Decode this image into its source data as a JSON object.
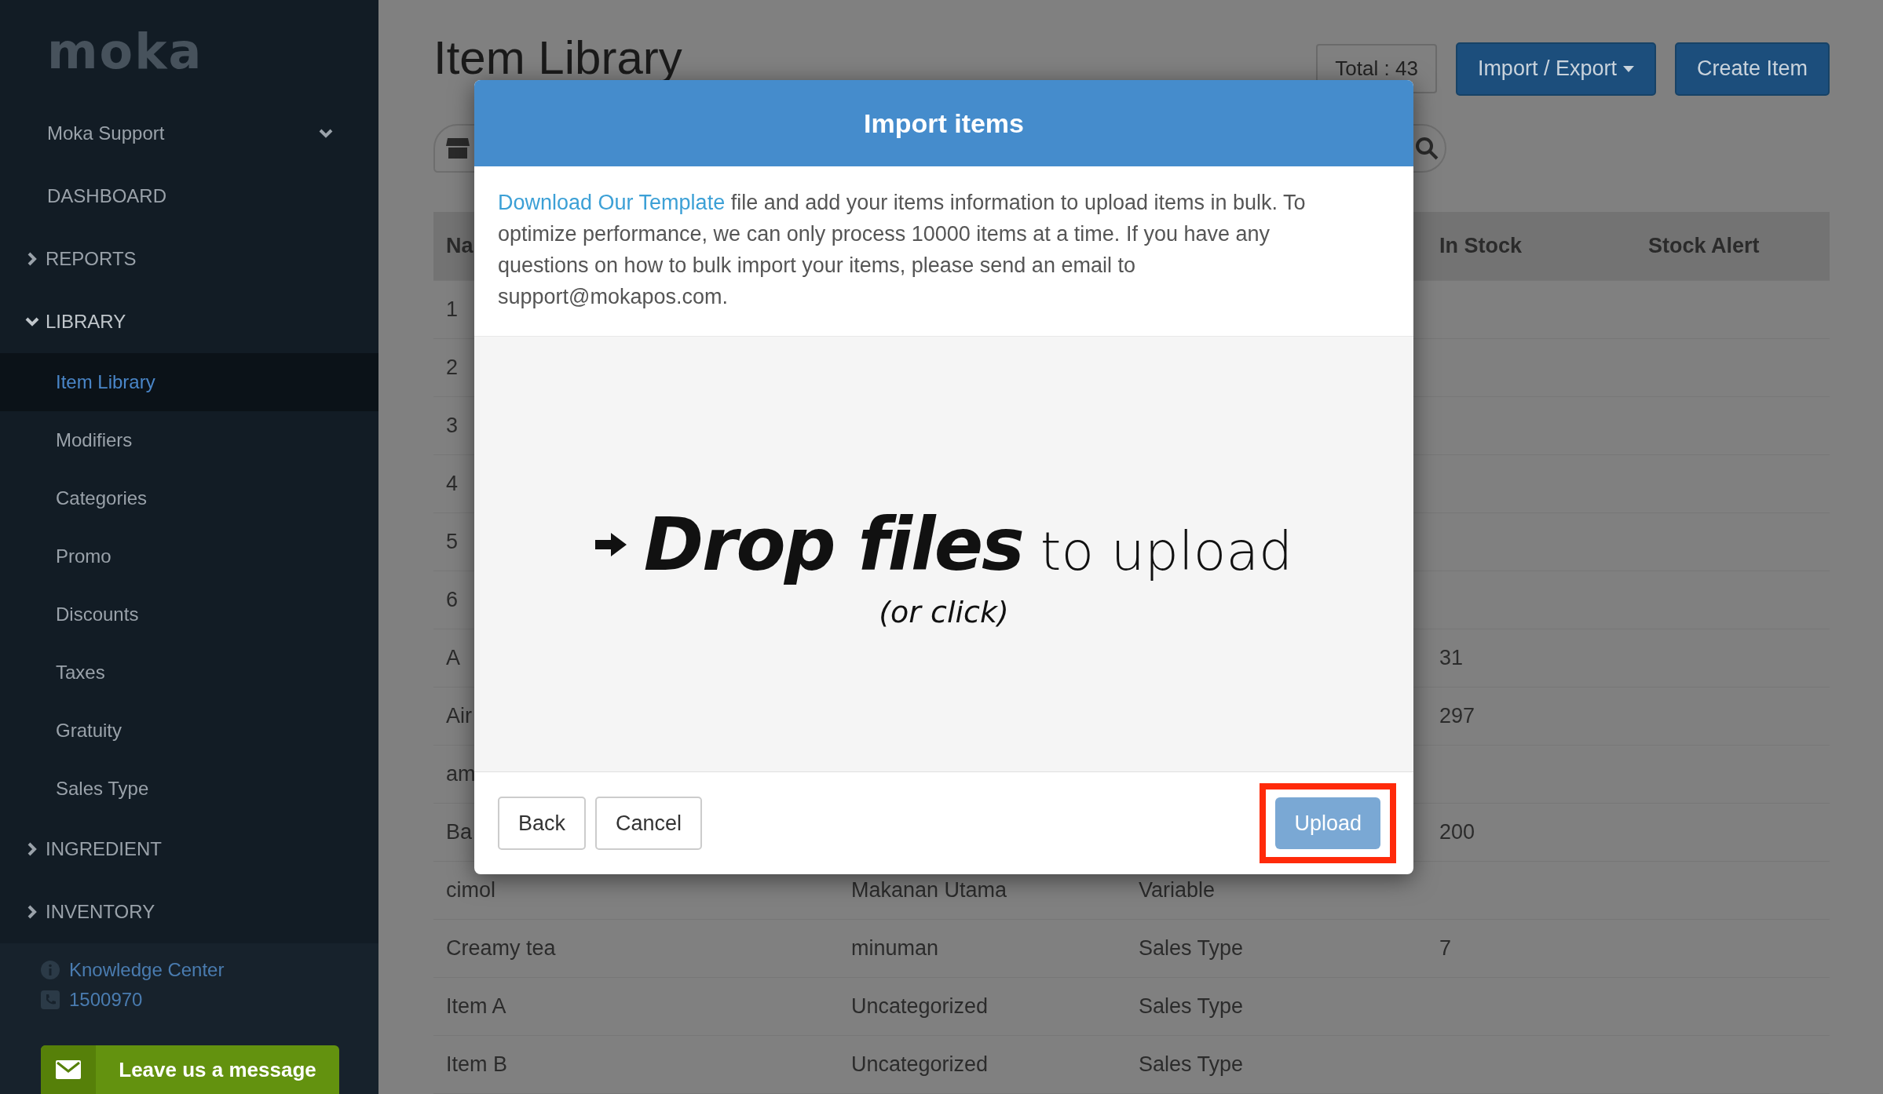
{
  "sidebar": {
    "logo": "moka",
    "account": "Moka Support",
    "items": [
      {
        "label": "DASHBOARD",
        "kind": "link"
      },
      {
        "label": "REPORTS",
        "kind": "section",
        "expanded": false
      },
      {
        "label": "LIBRARY",
        "kind": "section",
        "expanded": true,
        "children": [
          {
            "label": "Item Library",
            "selected": true
          },
          {
            "label": "Modifiers",
            "selected": false
          },
          {
            "label": "Categories",
            "selected": false
          },
          {
            "label": "Promo",
            "selected": false
          },
          {
            "label": "Discounts",
            "selected": false
          },
          {
            "label": "Taxes",
            "selected": false
          },
          {
            "label": "Gratuity",
            "selected": false
          },
          {
            "label": "Sales Type",
            "selected": false
          }
        ]
      },
      {
        "label": "INGREDIENT",
        "kind": "section",
        "expanded": false
      },
      {
        "label": "INVENTORY",
        "kind": "section",
        "expanded": false
      }
    ],
    "links": [
      {
        "label": "Knowledge Center",
        "kind": "info"
      },
      {
        "label": "1500970",
        "kind": "phone"
      }
    ],
    "message_button": "Leave us a message"
  },
  "main": {
    "title": "Item Library",
    "total": "Total : 43",
    "buttons": [
      {
        "label": "Import / Export",
        "kind": "dropdown"
      },
      {
        "label": "Create Item",
        "kind": "plain"
      }
    ],
    "table": {
      "header": {
        "name": "Na",
        "in_stock": "In Stock",
        "stock_alert": "Stock Alert"
      },
      "rows": [
        {
          "name": "1"
        },
        {
          "name": "2"
        },
        {
          "name": "3"
        },
        {
          "name": "4"
        },
        {
          "name": "5"
        },
        {
          "name": "6"
        },
        {
          "name": "A",
          "in_stock": "31"
        },
        {
          "name": "Air",
          "in_stock": "297"
        },
        {
          "name": "am"
        },
        {
          "name": "Ba",
          "in_stock": "200"
        },
        {
          "name": "cimol",
          "category": "Makanan Utama",
          "type": "Variable"
        },
        {
          "name": "Creamy tea",
          "category": "minuman",
          "type": "Sales Type",
          "in_stock": "7"
        },
        {
          "name": "Item A",
          "category": "Uncategorized",
          "type": "Sales Type"
        },
        {
          "name": "Item B",
          "category": "Uncategorized",
          "type": "Sales Type"
        }
      ]
    }
  },
  "modal": {
    "title": "Import items",
    "link": "Download Our Template",
    "text": " file and add your items information to upload items in bulk. To optimize performance, we can only process 10000 items at a time. If you have any questions on how to bulk import your items, please send an email to support@mokapos.com.",
    "dropzone": {
      "headline": "Drop files",
      "tail": "to upload",
      "hint": "(or click)"
    },
    "buttons": [
      {
        "label": "Back"
      },
      {
        "label": "Cancel"
      }
    ],
    "upload": {
      "label": "Upload",
      "disabled": true,
      "highlighted": true
    }
  }
}
